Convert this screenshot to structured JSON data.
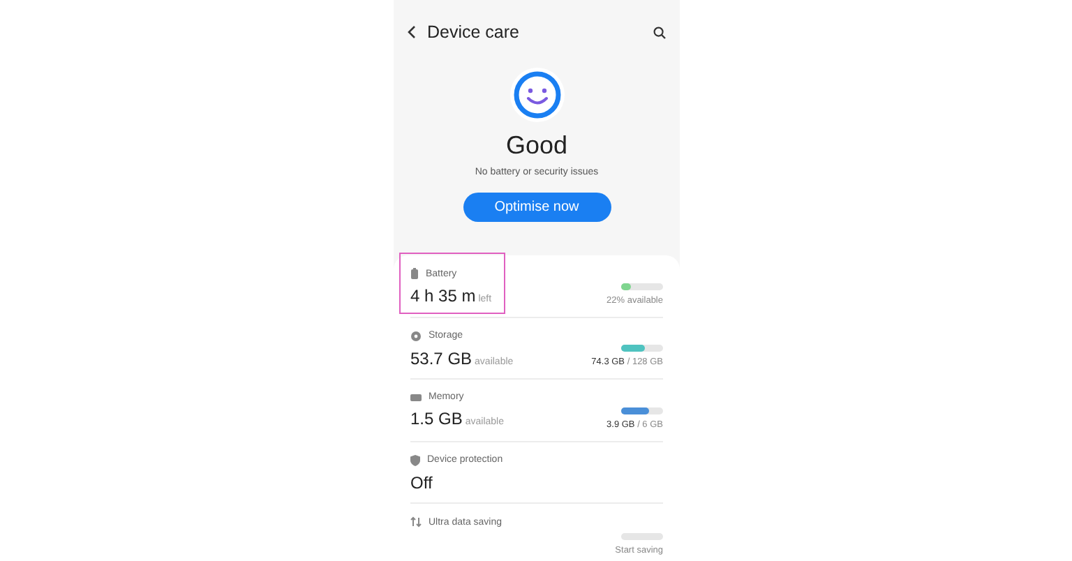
{
  "header": {
    "title": "Device care"
  },
  "status": {
    "title": "Good",
    "subtitle": "No battery or security issues",
    "button": "Optimise now"
  },
  "items": [
    {
      "kind": "meter",
      "label": "Battery",
      "value": "4 h 35 m",
      "unit": "left",
      "reading": "22% available",
      "level": 0.22,
      "color": "#7fd58f",
      "highlighted": true
    },
    {
      "kind": "meter",
      "label": "Storage",
      "value": "53.7 GB",
      "unit": "available",
      "reading": "**74.3 GB** / 128 GB",
      "level": 0.58,
      "color": "#4fc3c0",
      "highlighted": false
    },
    {
      "kind": "meter",
      "label": "Memory",
      "value": "1.5 GB",
      "unit": "available",
      "reading": "**3.9 GB** / 6 GB",
      "level": 0.65,
      "color": "#4a8fd8",
      "highlighted": false
    },
    {
      "kind": "plain",
      "label": "Device protection",
      "value": "Off",
      "highlighted": false
    },
    {
      "kind": "meter",
      "label": "Ultra data saving",
      "reading": "Start saving",
      "highlighted": false
    }
  ]
}
